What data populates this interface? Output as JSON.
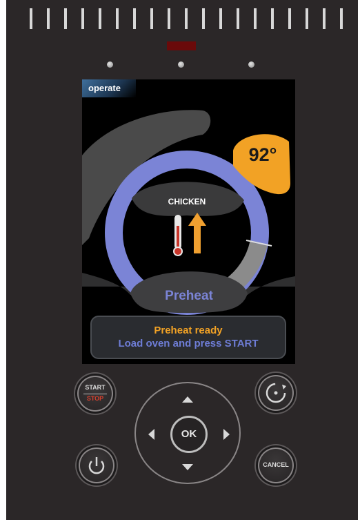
{
  "screen": {
    "mode_label": "operate",
    "temperature": "92°",
    "food_type": "CHICKEN",
    "phase": "Preheat",
    "message_line1": "Preheat ready",
    "message_line2": "Load oven and press START"
  },
  "controls": {
    "start_label": "START",
    "stop_label": "STOP",
    "ok_label": "OK",
    "cancel_label": "CANCEL"
  },
  "icons": [
    "power-icon",
    "cycle-icon",
    "thermometer-icon",
    "up-arrow-icon",
    "arrow-up-icon",
    "arrow-down-icon",
    "arrow-left-icon",
    "arrow-right-icon"
  ],
  "colors": {
    "panel": "#2b2728",
    "accent_orange": "#f2a225",
    "gauge_blue": "#7b84d6",
    "status_led": "#6a0a0a"
  }
}
